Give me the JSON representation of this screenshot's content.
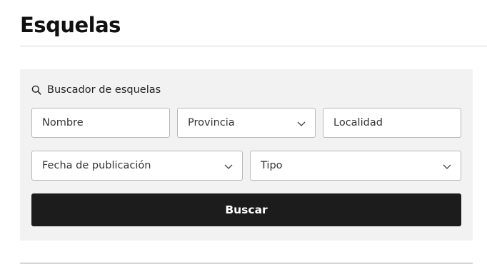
{
  "page": {
    "title": "Esquelas"
  },
  "search": {
    "heading": "Buscador de esquelas",
    "heading_icon": "search-icon",
    "fields": {
      "nombre_placeholder": "Nombre",
      "provincia_value": "Provincia",
      "localidad_placeholder": "Localidad",
      "fecha_value": "Fecha de publicación",
      "tipo_value": "Tipo"
    },
    "submit_label": "Buscar"
  },
  "colors": {
    "panel_background": "#f2f2f2",
    "button_background": "#1c1c1c",
    "button_text": "#ffffff",
    "field_border": "#b8b8b8"
  }
}
